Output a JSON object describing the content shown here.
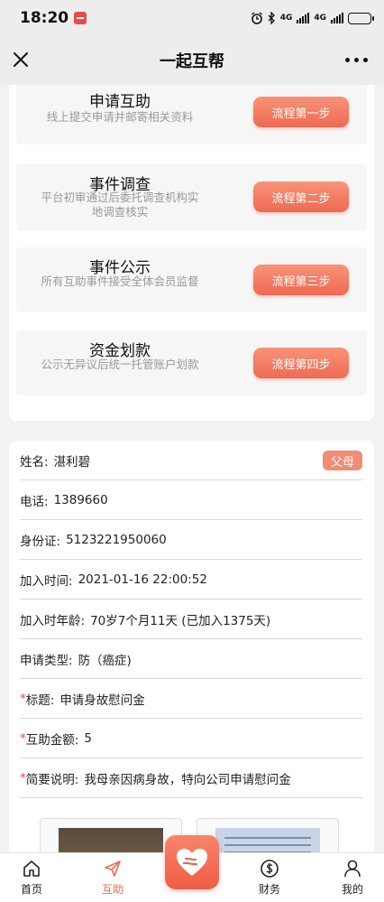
{
  "status_bar": {
    "time": "18:20",
    "network_1": "4G",
    "network_2": "4G"
  },
  "nav": {
    "title": "一起互帮"
  },
  "flow_steps": [
    {
      "title": "申请互助",
      "desc": "线上提交申请并邮寄相关资料",
      "button": "流程第一步"
    },
    {
      "title": "事件调查",
      "desc": "平台初审通过后委托调查机构实地调查核实",
      "button": "流程第二步"
    },
    {
      "title": "事件公示",
      "desc": "所有互助事件接受全体会员监督",
      "button": "流程第三步"
    },
    {
      "title": "资金划款",
      "desc": "公示无异议后统一托管账户划款",
      "button": "流程第四步"
    }
  ],
  "applicant": {
    "name_label": "姓名:",
    "name_value": "湛利碧",
    "relation_tag": "父母",
    "phone_label": "电话:",
    "phone_value": "1389660",
    "id_label": "身份证:",
    "id_value": "5123221950060",
    "join_time_label": "加入时间:",
    "join_time_value": "2021-01-16 22:00:52",
    "join_age_label": "加入时年龄:",
    "join_age_value": "70岁7个月11天 (已加入1375天)",
    "type_label": "申请类型:",
    "type_value": "防（癌症)",
    "title_label": "标题:",
    "title_value": "申请身故慰问金",
    "amount_label": "互助金额:",
    "amount_value": "5",
    "summary_label": "简要说明:",
    "summary_value": "我母亲因病身故，特向公司申请慰问金",
    "required_mark": "*"
  },
  "tabs": [
    {
      "label": "首页",
      "icon": "home-icon"
    },
    {
      "label": "互助",
      "icon": "send-icon"
    },
    {
      "label": "财务",
      "icon": "dollar-circle-icon"
    },
    {
      "label": "我的",
      "icon": "user-icon"
    }
  ],
  "colors": {
    "accent": "#ef6c50",
    "button_gradient_top": "#f89378",
    "button_gradient_bottom": "#ee6a52",
    "required": "#e04a3a"
  }
}
